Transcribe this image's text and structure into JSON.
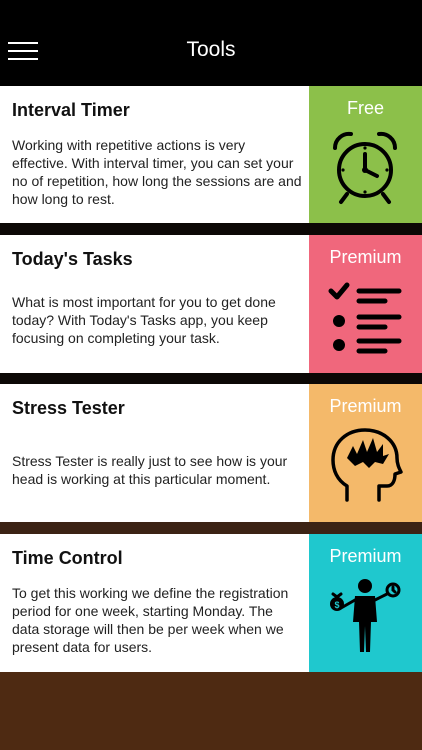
{
  "header": {
    "title": "Tools"
  },
  "cards": [
    {
      "title": "Interval Timer",
      "description": "Working with repetitive actions is very effective. With interval timer, you can set your no of repetition, how long the sessions are and how long to rest.",
      "tier": "Free",
      "icon": "alarm-clock-icon",
      "color": "#8cc04a"
    },
    {
      "title": "Today's Tasks",
      "description": "What is most important for you to get done today? With Today's Tasks app, you keep focusing on completing your task.",
      "tier": "Premium",
      "icon": "checklist-icon",
      "color": "#f0677c"
    },
    {
      "title": "Stress Tester",
      "description": "Stress Tester is really just to see how is your head is working at this particular moment.",
      "tier": "Premium",
      "icon": "stressed-head-icon",
      "color": "#f4b96a"
    },
    {
      "title": "Time Control",
      "description": "To get this working we define the registration period for one week, starting Monday. The data storage will then be per week when we present data for users.",
      "tier": "Premium",
      "icon": "businessman-balance-icon",
      "color": "#1fc8ce"
    }
  ],
  "colors": {
    "header_bg": "#000000",
    "divider_dark": "#0c0806",
    "divider_brown": "#3c2315",
    "bottom_fill": "#4e2a12"
  }
}
